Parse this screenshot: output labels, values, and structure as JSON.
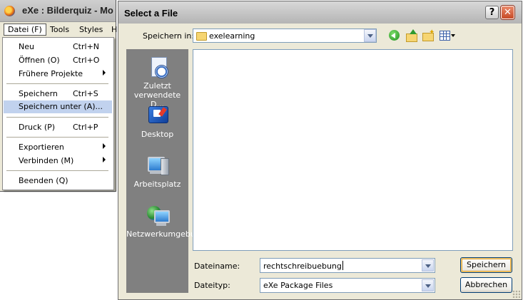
{
  "background_window": {
    "title": "eXe : Bilderquiz - Mo",
    "menubar": {
      "datei": "Datei (F)",
      "tools": "Tools",
      "styles": "Styles",
      "h": "H"
    },
    "file_menu": [
      {
        "label": "Neu",
        "shortcut": "Ctrl+N"
      },
      {
        "label": "Öffnen (O)",
        "shortcut": "Ctrl+O"
      },
      {
        "label": "Frühere Projekte",
        "submenu": true
      },
      {
        "label": "Speichern",
        "shortcut": "Ctrl+S"
      },
      {
        "label": "Speichern unter (A)...",
        "highlighted": true
      },
      {
        "label": "Druck (P)",
        "shortcut": "Ctrl+P"
      },
      {
        "label": "Exportieren",
        "submenu": true
      },
      {
        "label": "Verbinden (M)",
        "submenu": true
      },
      {
        "label": "Beenden (Q)"
      }
    ]
  },
  "dialog": {
    "title": "Select a File",
    "help_button": "?",
    "close_button": "✕",
    "save_in_label": "Speichern in:",
    "save_in_value": "exelearning",
    "toolbar_icons": [
      "back-icon",
      "up-folder-icon",
      "new-folder-icon",
      "views-menu-icon"
    ],
    "places": [
      {
        "label": "Zuletzt verwendete D...",
        "icon": "recent-documents-icon"
      },
      {
        "label": "Desktop",
        "icon": "desktop-icon"
      },
      {
        "label": "Arbeitsplatz",
        "icon": "my-computer-icon"
      },
      {
        "label": "Netzwerkumgebung",
        "icon": "network-icon"
      }
    ],
    "filename_label": "Dateiname:",
    "filename_value": "rechtschreibuebung",
    "filetype_label": "Dateityp:",
    "filetype_value": "eXe Package Files",
    "save_button": "Speichern",
    "cancel_button": "Abbrechen"
  }
}
